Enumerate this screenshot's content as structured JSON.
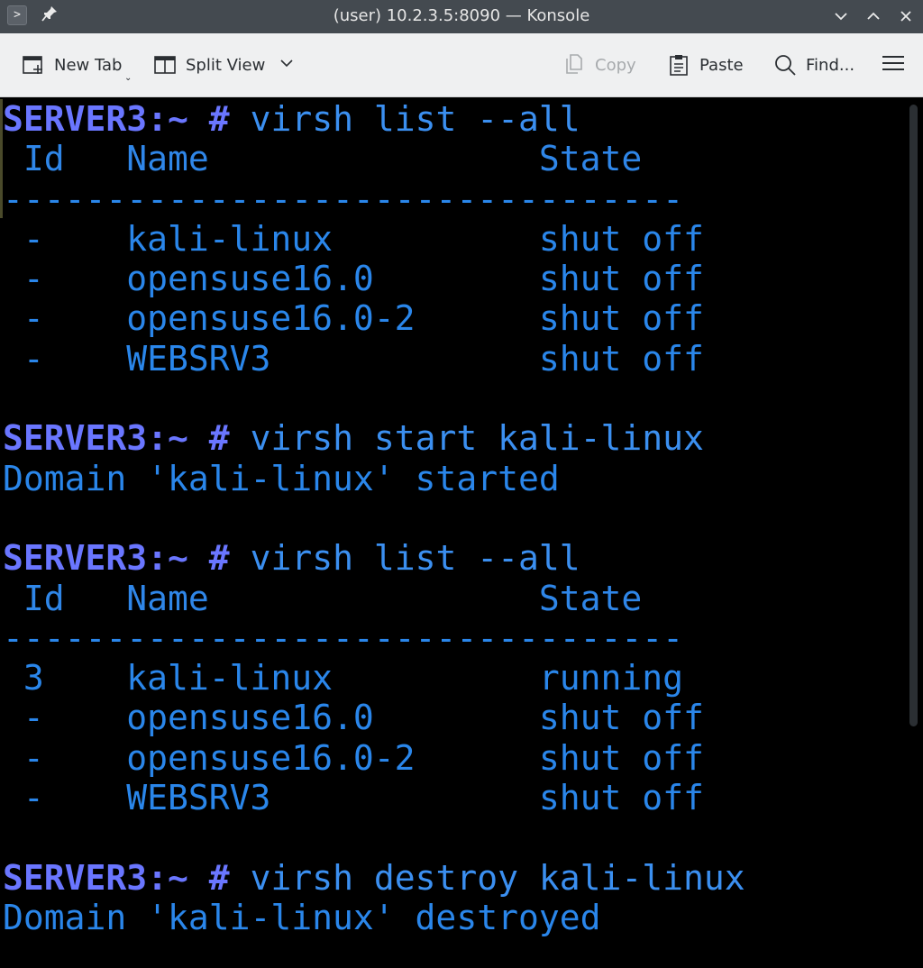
{
  "window": {
    "title": "(user) 10.2.3.5:8090 — Konsole",
    "app_icon_glyph": ">",
    "pin_icon_glyph": "📌",
    "controls": [
      "minimize",
      "maximize",
      "close"
    ]
  },
  "toolbar": {
    "new_tab_label": "New Tab",
    "split_view_label": "Split View",
    "copy_label": "Copy",
    "paste_label": "Paste",
    "find_label": "Find...",
    "copy_enabled": false
  },
  "terminal": {
    "colors": {
      "prompt": "#6a76ff",
      "text": "#2a86ea",
      "background": "#000000"
    },
    "prompt_host": "SERVER3",
    "prompt_tail": ":~ #",
    "blocks": [
      {
        "command": "virsh list --all",
        "header": " Id   Name                State",
        "separator": "---------------------------------",
        "rows": [
          " -    kali-linux          shut off",
          " -    opensuse16.0        shut off",
          " -    opensuse16.0-2      shut off",
          " -    WEBSRV3             shut off"
        ]
      },
      {
        "command": "virsh start kali-linux",
        "output": "Domain 'kali-linux' started"
      },
      {
        "command": "virsh list --all",
        "header": " Id   Name                State",
        "separator": "---------------------------------",
        "rows": [
          " 3    kali-linux          running",
          " -    opensuse16.0        shut off",
          " -    opensuse16.0-2      shut off",
          " -    WEBSRV3             shut off"
        ]
      },
      {
        "command": "virsh destroy kali-linux",
        "output": "Domain 'kali-linux' destroyed"
      }
    ]
  }
}
